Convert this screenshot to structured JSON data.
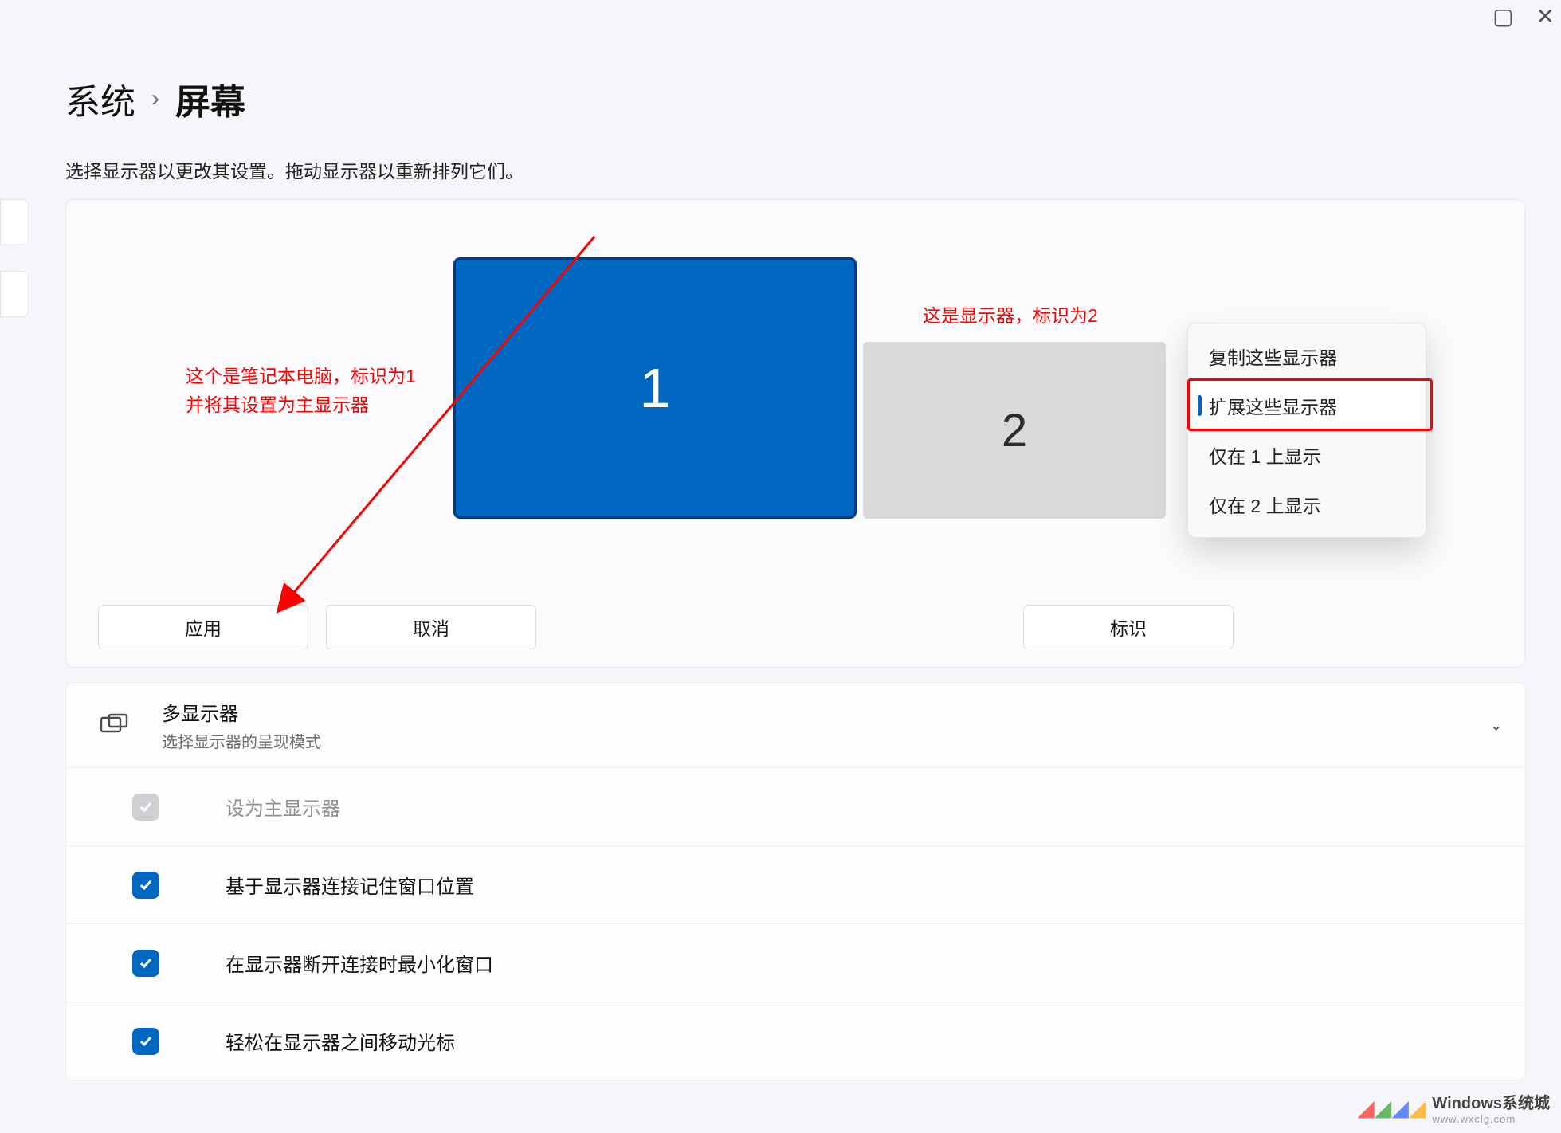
{
  "breadcrumb": {
    "root": "系统",
    "separator": "›",
    "current": "屏幕"
  },
  "subtitle": "选择显示器以更改其设置。拖动显示器以重新排列它们。",
  "window_controls": {
    "maximize": "▢",
    "close": "✕"
  },
  "monitors": {
    "m1": "1",
    "m2": "2"
  },
  "annotations": {
    "a1_line1": "这个是笔记本电脑，标识为1",
    "a1_line2": "并将其设置为主显示器",
    "a2": "这是显示器，标识为2"
  },
  "buttons": {
    "apply": "应用",
    "cancel": "取消",
    "identify": "标识"
  },
  "popup": {
    "opt1": "复制这些显示器",
    "opt2": "扩展这些显示器",
    "opt3": "仅在 1 上显示",
    "opt4": "仅在 2 上显示"
  },
  "multi_display": {
    "title": "多显示器",
    "desc": "选择显示器的呈现模式",
    "set_main": "设为主显示器",
    "remember_windows": "基于显示器连接记住窗口位置",
    "minimize_on_disconnect": "在显示器断开连接时最小化窗口",
    "easy_move": "轻松在显示器之间移动光标"
  },
  "watermark": {
    "brand": "Windows系统城",
    "url": "www.wxclg.com"
  },
  "colors": {
    "accent": "#0067c0",
    "annotation": "#ff0000"
  }
}
